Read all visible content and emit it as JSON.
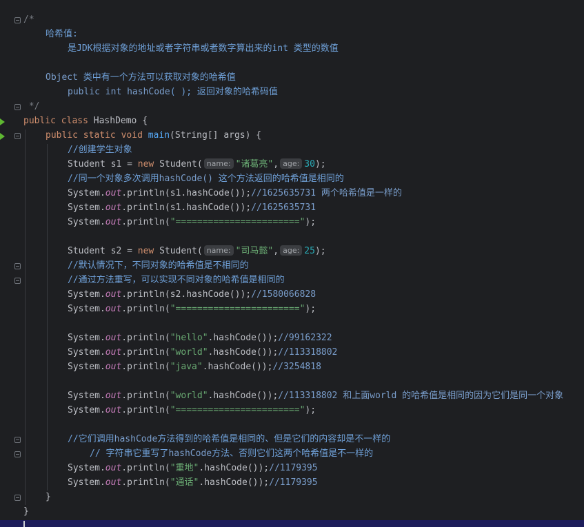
{
  "doc_comment": {
    "open": "/*",
    "l1": "哈希值:",
    "l2": "是JDK根据对象的地址或者字符串或者数字算出来的int 类型的数值",
    "l3a": "Object",
    "l3b": " 类中有一个方法可以获取对象的哈希值",
    "l4a": "public int hashCode",
    "l4b": "( ); 返回对象的哈希码值",
    "close": " */"
  },
  "code": {
    "public": "public",
    "class_kw": "class",
    "class_name": " HashDemo {",
    "static": "static",
    "void": "void",
    "main": "main",
    "main_args": "(String[] args) {",
    "c_create": "//创建学生对象",
    "student_type": "Student ",
    "s1": "s1",
    "s2": "s2",
    "eq": " = ",
    "new_kw": "new",
    "student_ctor": " Student(",
    "hint_name": "name:",
    "hint_age": "age:",
    "s1_name": "\"诸葛亮\"",
    "s1_age": "30",
    "s2_name": "\"司马懿\"",
    "s2_age": "25",
    "comma": ",",
    "end_paren": ");",
    "c_same1": "//同一个对象多次调用",
    "c_same2": "hashCode()",
    "c_same3": " 这个方法返回的哈希值是相同的",
    "sys": "System.",
    "out": "out",
    "println": ".println(",
    "s1_hash": "s1.hashCode());",
    "s2_hash": "s2.hashCode());",
    "r1": "//1625635731 两个哈希值是一样的",
    "r2": "//1625635731",
    "separator": "\"=======================\"",
    "c_default": "//默认情况下，不同对象的哈希值是不相同的",
    "c_override": "//通过方法重写，可以实现不同对象的哈希值是相同的",
    "r_s2": "//1580066828",
    "hello": "\"hello\"",
    "world": "\"world\"",
    "java": "\"java\"",
    "hash_call": ".hashCode());",
    "r_hello": "//99162322",
    "r_world": "//113318802",
    "r_java": "//3254818",
    "r_world2": "//113318802 和上面world 的哈希值是相同的因为它们是同一个对象",
    "c_they1": "//它们调用",
    "c_they2": "hashCode",
    "c_they3": "方法得到的哈希值是相同的、但是它们的内容却是不一样的",
    "c_str1": "// 字符串它重写了",
    "c_str2": "hashCode",
    "c_str3": "方法、否则它们这两个哈希值是不一样的",
    "zhongdi": "\"重地\"",
    "tonghua": "\"通话\"",
    "r_zd": "//1179395",
    "r_th": "//1179395",
    "close_method": "}",
    "close_class": "}"
  },
  "colors": {
    "background": "#1e1f22",
    "keyword": "#cf8e6d",
    "string": "#6aab73",
    "number": "#2aacb8",
    "static_field": "#c77dbb",
    "method_decl": "#56a8f5",
    "comment": "#7a9ecc",
    "run_arrow": "#5fb832",
    "status_bar": "#1c1c5a"
  },
  "icons": {
    "run": "run-arrow-icon",
    "fold": "fold-icon"
  }
}
